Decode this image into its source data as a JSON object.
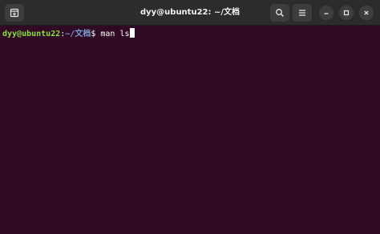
{
  "window": {
    "title": "dyy@ubuntu22: ~/文档"
  },
  "titlebar": {
    "new_tab_icon": "new-tab-icon",
    "search_icon": "search-icon",
    "menu_icon": "hamburger-menu-icon",
    "minimize_icon": "minimize-icon",
    "maximize_icon": "maximize-icon",
    "close_icon": "close-icon"
  },
  "terminal": {
    "prompt_user": "dyy@ubuntu22",
    "prompt_colon": ":",
    "prompt_path": "~/文档",
    "prompt_symbol": "$ ",
    "command": "man ls"
  },
  "colors": {
    "background": "#300a24",
    "titlebar": "#2c2c2c",
    "prompt_user": "#8ae234",
    "prompt_path": "#729fcf",
    "text": "#ffffff"
  }
}
